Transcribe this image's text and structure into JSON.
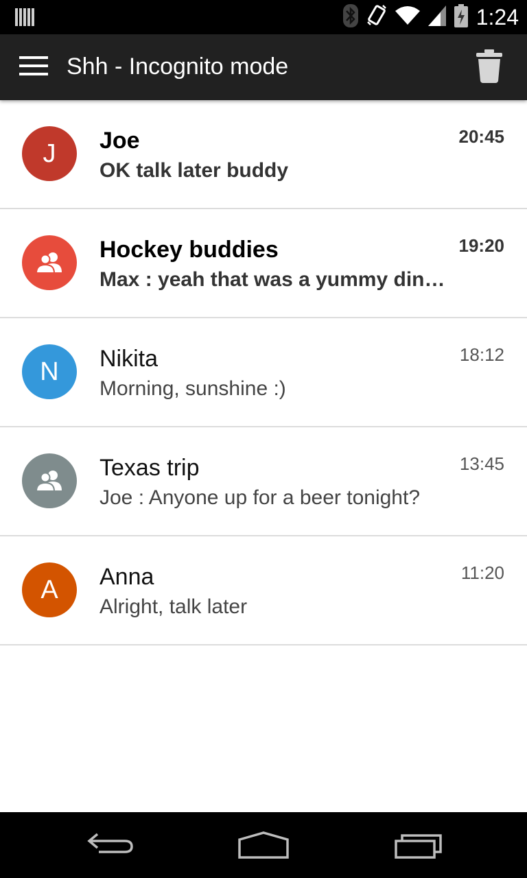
{
  "status_bar": {
    "time": "1:24",
    "icons": [
      "notification-icon",
      "bluetooth-icon",
      "vibrate-icon",
      "wifi-icon",
      "signal-icon",
      "battery-icon"
    ]
  },
  "app_bar": {
    "title": "Shh - Incognito mode",
    "menu_icon": "menu-icon",
    "action_icon": "trash-icon"
  },
  "conversations": [
    {
      "avatar_letter": "J",
      "avatar_type": "letter",
      "avatar_color": "#c0392b",
      "name": "Joe",
      "message": "OK talk later buddy",
      "time": "20:45",
      "unread": true
    },
    {
      "avatar_letter": "",
      "avatar_type": "group",
      "avatar_color": "#e74c3c",
      "name": "Hockey buddies",
      "message": "Max : yeah that was a yummy dinn…",
      "time": "19:20",
      "unread": true
    },
    {
      "avatar_letter": "N",
      "avatar_type": "letter",
      "avatar_color": "#3498db",
      "name": "Nikita",
      "message": "Morning, sunshine :)",
      "time": "18:12",
      "unread": false
    },
    {
      "avatar_letter": "",
      "avatar_type": "group",
      "avatar_color": "#7f8c8d",
      "name": "Texas trip",
      "message": "Joe : Anyone up for a beer tonight?",
      "time": "13:45",
      "unread": false
    },
    {
      "avatar_letter": "A",
      "avatar_type": "letter",
      "avatar_color": "#d35400",
      "name": "Anna",
      "message": "Alright, talk later",
      "time": "11:20",
      "unread": false
    }
  ],
  "nav_bar": {
    "buttons": [
      "back-icon",
      "home-icon",
      "recents-icon"
    ]
  }
}
